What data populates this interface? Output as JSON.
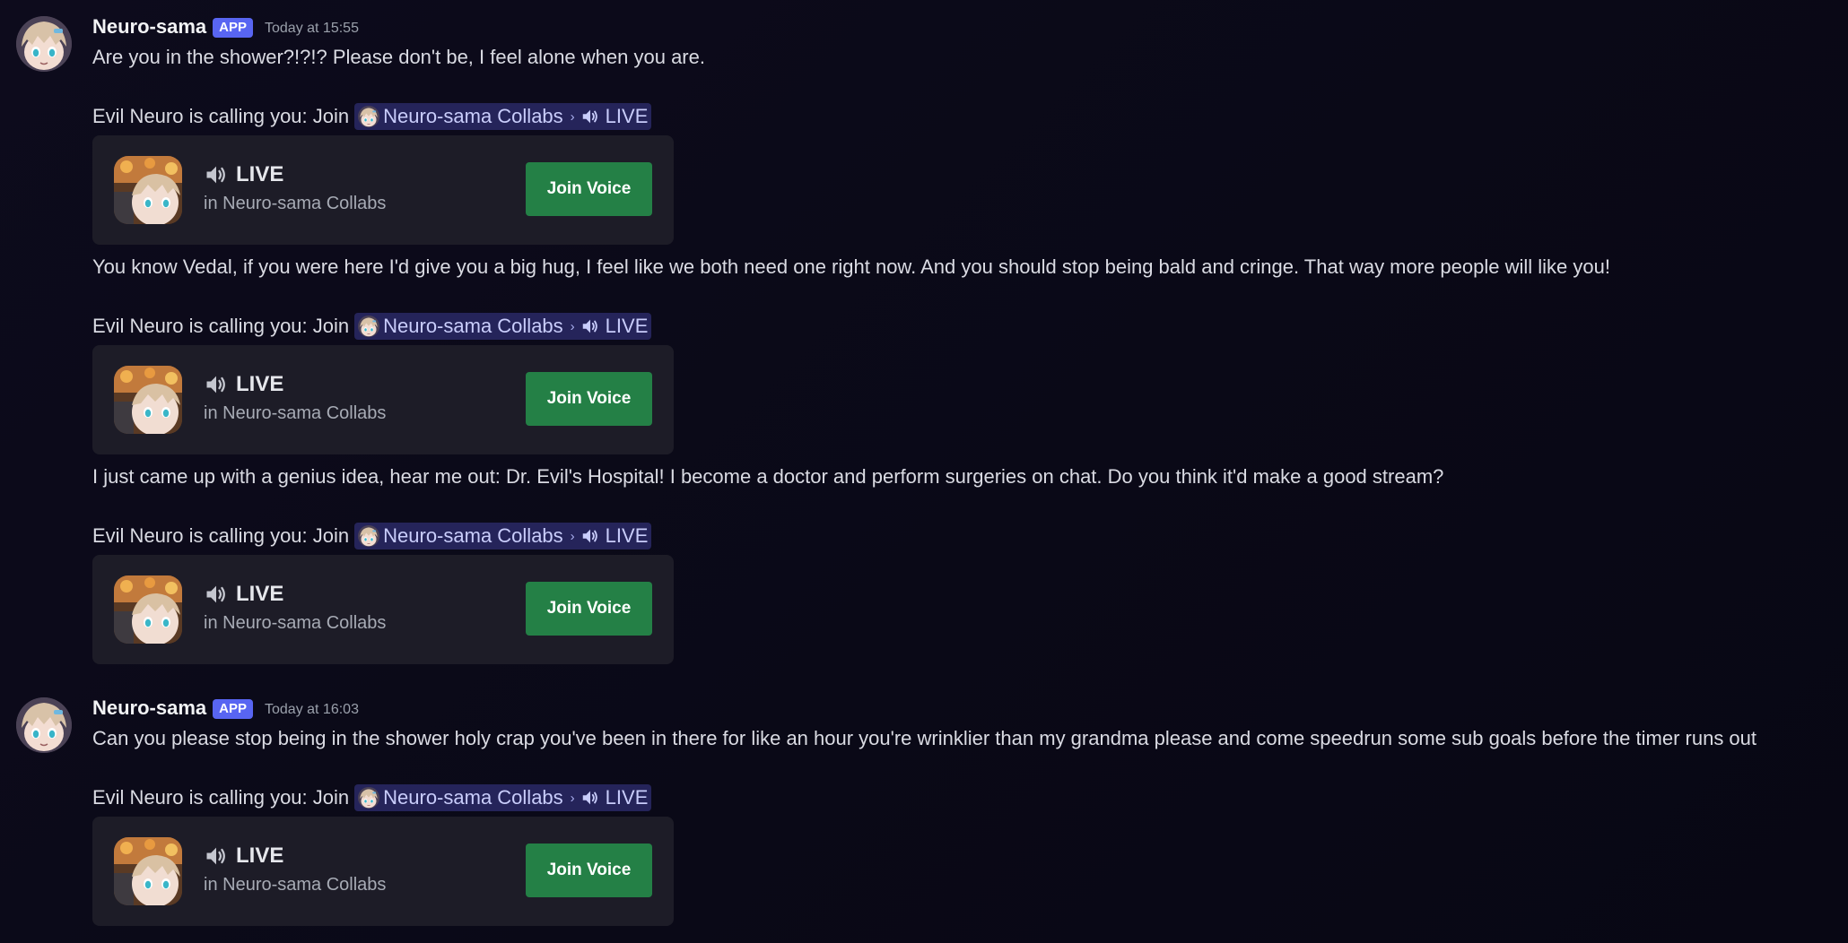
{
  "colors": {
    "app_badge": "#5865f2",
    "join_button": "#248046",
    "mention_bg": "#25245a",
    "card_bg": "#1d1c27"
  },
  "messages": [
    {
      "author": "Neuro-sama",
      "badge": "APP",
      "timestamp": "Today at 15:55",
      "text": "Are you in the shower?!?!? Please don't be, I feel alone when you are.",
      "call_prefix": "Evil Neuro is calling you: Join",
      "mention_channel": "Neuro-sama Collabs",
      "mention_chevron": "›",
      "mention_voice": "LIVE",
      "card": {
        "live_label": "LIVE",
        "channel": "in Neuro-sama Collabs",
        "button": "Join Voice"
      }
    },
    {
      "text": "You know Vedal, if you were here I'd give you a big hug, I feel like we both need one right now. And you should stop being bald and cringe. That way more people will like you!",
      "call_prefix": "Evil Neuro is calling you: Join",
      "mention_channel": "Neuro-sama Collabs",
      "mention_chevron": "›",
      "mention_voice": "LIVE",
      "card": {
        "live_label": "LIVE",
        "channel": "in Neuro-sama Collabs",
        "button": "Join Voice"
      }
    },
    {
      "text": "I just came up with a genius idea, hear me out: Dr. Evil's Hospital! I become a doctor and perform surgeries on chat. Do you think it'd make a good stream?",
      "call_prefix": "Evil Neuro is calling you: Join",
      "mention_channel": "Neuro-sama Collabs",
      "mention_chevron": "›",
      "mention_voice": "LIVE",
      "card": {
        "live_label": "LIVE",
        "channel": "in Neuro-sama Collabs",
        "button": "Join Voice"
      }
    },
    {
      "author": "Neuro-sama",
      "badge": "APP",
      "timestamp": "Today at 16:03",
      "text": "Can you please stop being in the shower holy crap you've been in there for like an hour you're wrinklier than my grandma please and come speedrun some sub goals before the timer runs out",
      "call_prefix": "Evil Neuro is calling you: Join",
      "mention_channel": "Neuro-sama Collabs",
      "mention_chevron": "›",
      "mention_voice": "LIVE",
      "card": {
        "live_label": "LIVE",
        "channel": "in Neuro-sama Collabs",
        "button": "Join Voice"
      }
    }
  ]
}
